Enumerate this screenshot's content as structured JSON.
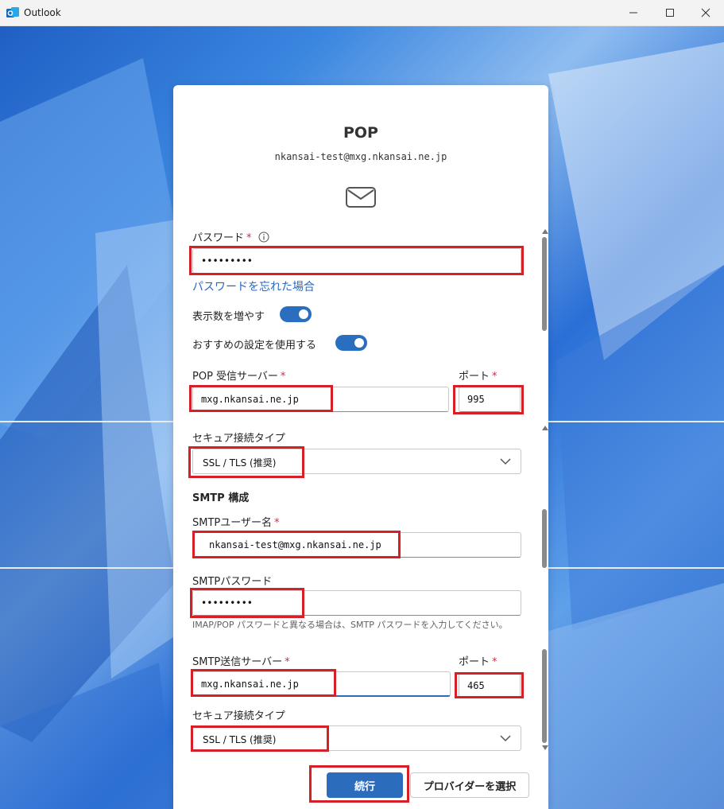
{
  "window": {
    "app_title": "Outlook"
  },
  "dialog": {
    "title": "POP",
    "email": "nkansai-test@mxg.nkansai.ne.jp",
    "required_mark": "*",
    "password": {
      "label": "パスワード",
      "value": "•••••••••"
    },
    "forgot_password": "パスワードを忘れた場合",
    "show_more": "表示数を増やす",
    "use_recommended": "おすすめの設定を使用する",
    "pop_server": {
      "label": "POP 受信サーバー",
      "value": "mxg.nkansai.ne.jp"
    },
    "pop_port": {
      "label": "ポート",
      "value": "995"
    },
    "pop_security": {
      "label": "セキュア接続タイプ",
      "value": "SSL / TLS (推奨)"
    },
    "smtp_section": "SMTP 構成",
    "smtp_user": {
      "label": "SMTPユーザー名",
      "value": "nkansai-test@mxg.nkansai.ne.jp"
    },
    "smtp_password": {
      "label": "SMTPパスワード",
      "value": "•••••••••"
    },
    "smtp_hint": "IMAP/POP パスワードと異なる場合は、SMTP パスワードを入力してください。",
    "smtp_server": {
      "label": "SMTP送信サーバー",
      "value": "mxg.nkansai.ne.jp"
    },
    "smtp_port": {
      "label": "ポート",
      "value": "465"
    },
    "smtp_security": {
      "label": "セキュア接続タイプ",
      "value": "SSL / TLS (推奨)"
    },
    "continue_button": "続行",
    "select_provider_button": "プロバイダーを選択"
  },
  "colors": {
    "accent": "#2b6cbd",
    "highlight_box": "#d71f27",
    "required": "#c4314b",
    "link": "#2a68c0"
  }
}
